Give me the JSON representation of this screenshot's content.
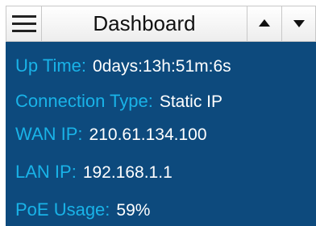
{
  "header": {
    "title": "Dashboard"
  },
  "colors": {
    "panel_bg": "#0d4a7d",
    "label": "#19b3e8",
    "value": "#ffffff"
  },
  "status": [
    {
      "label": "Up Time:",
      "value": "0days:13h:51m:6s"
    },
    {
      "label": "Connection Type:",
      "value": "Static IP"
    },
    {
      "label": "WAN IP:",
      "value": "210.61.134.100"
    },
    {
      "label": "LAN IP:",
      "value": "192.168.1.1"
    },
    {
      "label": "PoE Usage:",
      "value": "59%"
    }
  ]
}
